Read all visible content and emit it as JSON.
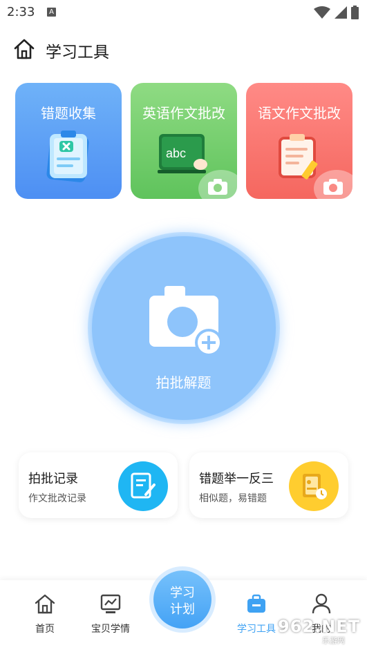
{
  "status_bar": {
    "time": "2:33",
    "notif_letter": "A"
  },
  "header": {
    "title": "学习工具"
  },
  "tool_cards": [
    {
      "title": "错题收集"
    },
    {
      "title": "英语作文批改",
      "art_text": "abc"
    },
    {
      "title": "语文作文批改"
    }
  ],
  "main_action": {
    "label": "拍批解题"
  },
  "records": [
    {
      "title": "拍批记录",
      "subtitle": "作文批改记录"
    },
    {
      "title": "错题举一反三",
      "subtitle": "相似题，易错题"
    }
  ],
  "bottom_nav": {
    "items": [
      {
        "label": "首页",
        "icon": "home-icon"
      },
      {
        "label": "宝贝学情",
        "icon": "monitor-icon"
      },
      {
        "label": "学习工具",
        "icon": "briefcase-icon",
        "active": true
      },
      {
        "label": "我的",
        "icon": "user-icon"
      }
    ],
    "center": {
      "line1": "学习",
      "line2": "计划"
    }
  },
  "watermark": {
    "text": "962.NET",
    "sub": "乐游网"
  },
  "colors": {
    "accent": "#3fa2f3",
    "card_blue": "#5a9ef5",
    "card_green": "#6ccb66",
    "card_red": "#f77069",
    "circle": "#8ec4fb"
  }
}
